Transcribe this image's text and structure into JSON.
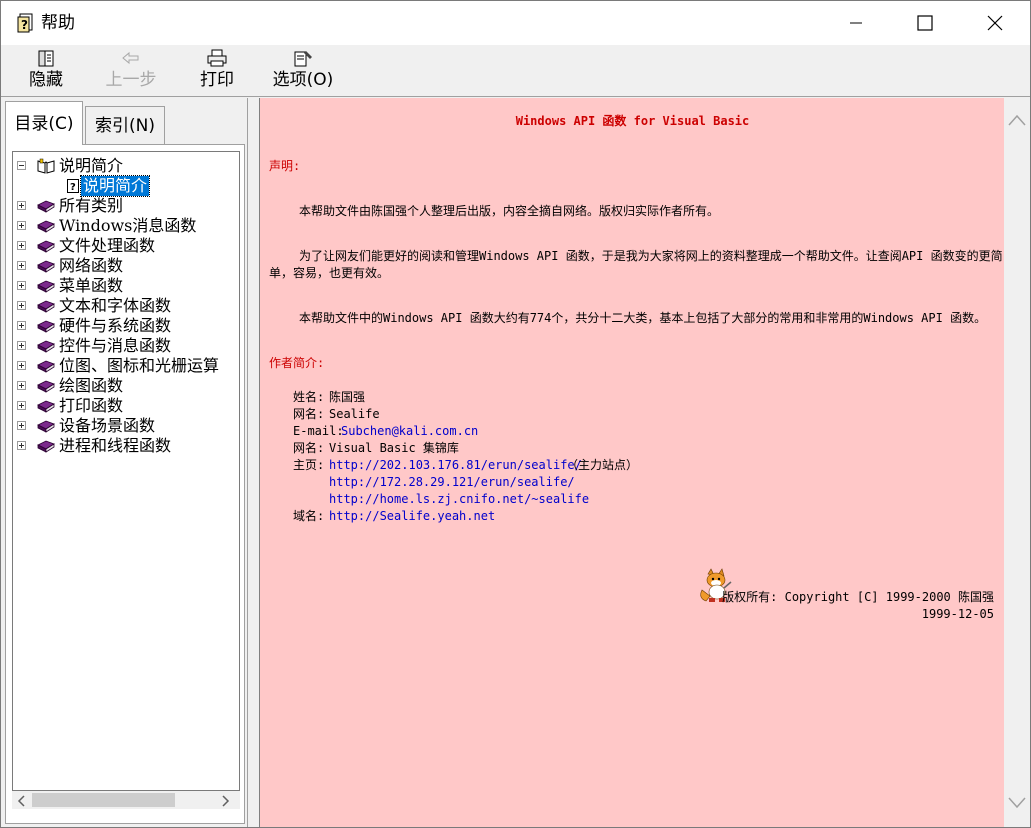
{
  "window": {
    "title": "帮助"
  },
  "toolbar": {
    "hide_label": "隐藏",
    "back_label": "上一步",
    "print_label": "打印",
    "options_label": "选项(O)"
  },
  "tabs": {
    "contents": "目录(C)",
    "index": "索引(N)"
  },
  "tree": {
    "root": "说明简介",
    "root_page": "说明简介",
    "items": [
      "所有类别",
      "Windows消息函数",
      "文件处理函数",
      "网络函数",
      "菜单函数",
      "文本和字体函数",
      "硬件与系统函数",
      "控件与消息函数",
      "位图、图标和光栅运算",
      "绘图函数",
      "打印函数",
      "设备场景函数",
      "进程和线程函数"
    ]
  },
  "content": {
    "heading": "Windows API 函数 for Visual Basic",
    "statement_title": "声明:",
    "para1": "本帮助文件由陈国强个人整理后出版，内容全摘自网络。版权归实际作者所有。",
    "para2_line1": "为了让网友们能更好的阅读和管理Windows API 函数，于是我为大家将网上的资料整理成一个帮助文件。让查阅API 函数变的更简",
    "para2_line2": "单，容易，也更有效。",
    "para3": "本帮助文件中的Windows API 函数大约有774个，共分十二大类，基本上包括了大部分的常用和非常用的Windows API 函数。",
    "author_title": "作者简介:",
    "name_label": "姓名:",
    "name_value": "陈国强",
    "nick_label": "网名:",
    "nick_value": "Sealife",
    "email_label": "E-mail:",
    "email_value": "Subchen@kali.com.cn",
    "site_label": "网名:",
    "site_value": "Visual Basic 集锦库",
    "home_label": "主页:",
    "home_url1": "http://202.103.176.81/erun/sealife/",
    "home_note": "（主力站点）",
    "home_url2": "http://172.28.29.121/erun/sealife/",
    "home_url3": "http://home.ls.zj.cnifo.net/~sealife",
    "domain_label": "域名:",
    "domain_value": "http://Sealife.yeah.net",
    "copyright": "版权所有: Copyright [C] 1999-2000 陈国强",
    "date": "1999-12-05"
  },
  "colors": {
    "content_bg": "#ffc8c8",
    "heading_red": "#cc0000",
    "link_blue": "#0000cc",
    "selection": "#0078d7"
  }
}
